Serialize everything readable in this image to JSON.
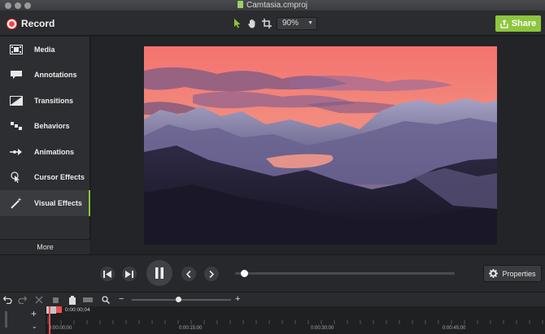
{
  "window": {
    "title": "Camtasia.cmproj"
  },
  "toolbar": {
    "record_label": "Record",
    "zoom_value": "90%",
    "share_label": "Share"
  },
  "sidebar": {
    "items": [
      {
        "label": "Media",
        "icon": "film-strip-icon"
      },
      {
        "label": "Annotations",
        "icon": "speech-bubble-icon"
      },
      {
        "label": "Transitions",
        "icon": "transition-icon"
      },
      {
        "label": "Behaviors",
        "icon": "behaviors-icon"
      },
      {
        "label": "Animations",
        "icon": "animation-arrow-icon"
      },
      {
        "label": "Cursor Effects",
        "icon": "cursor-effect-icon"
      },
      {
        "label": "Visual Effects",
        "icon": "magic-wand-icon"
      }
    ],
    "active_index": 6,
    "more_label": "More"
  },
  "playback": {
    "progress": 0.04,
    "properties_label": "Properties"
  },
  "timeline": {
    "zoom_level": 0.47,
    "current_time": "0:00:00;04",
    "ticks": [
      "0:00:00;00",
      "0:00:15;00",
      "0:00:30;00",
      "0:00:45;00"
    ]
  },
  "colors": {
    "accent": "#8cc63f",
    "record": "#ff4242",
    "playhead": "#ff4c4c"
  }
}
